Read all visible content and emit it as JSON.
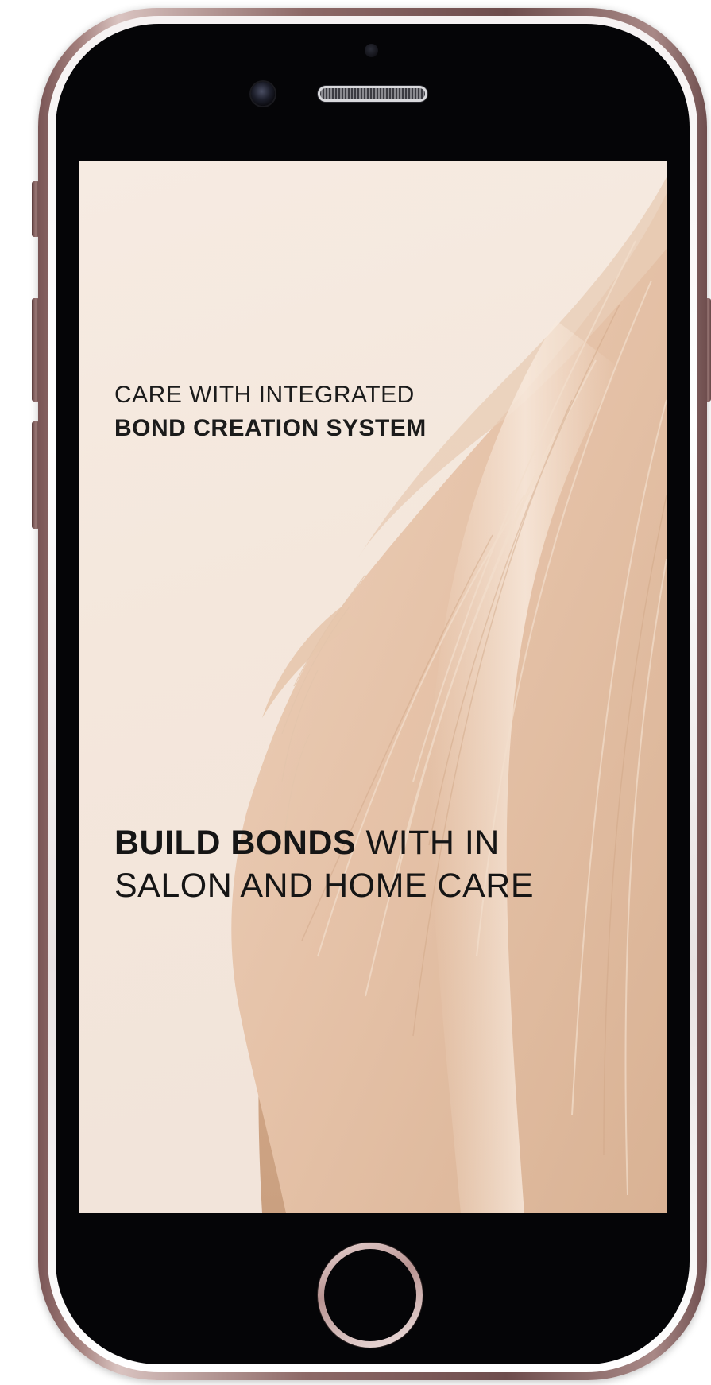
{
  "screen": {
    "tagline": {
      "line1": "CARE WITH INTEGRATED",
      "line2": "BOND CREATION SYSTEM"
    },
    "headline": {
      "bold_part": "BUILD BONDS",
      "normal_part": " WITH IN",
      "line2": "SALON AND HOME CARE"
    }
  },
  "colors": {
    "background": "#f4e7dc",
    "hair": "#e3c1a6",
    "text": "#151515",
    "phone_body": "#8d6967"
  },
  "icons": {
    "camera": "front-camera-icon",
    "speaker": "speaker-grill-icon",
    "home": "home-button-icon"
  }
}
